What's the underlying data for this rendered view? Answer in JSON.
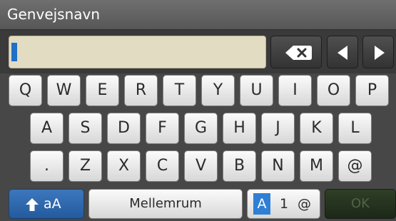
{
  "title": "Genvejsnavn",
  "input": {
    "value": ""
  },
  "controls": {
    "backspace_icon": "backspace-x-icon",
    "left_icon": "left-arrow-icon",
    "right_icon": "right-arrow-icon"
  },
  "keys": {
    "row1": [
      "Q",
      "W",
      "E",
      "R",
      "T",
      "Y",
      "U",
      "I",
      "O",
      "P"
    ],
    "row2": [
      "A",
      "S",
      "D",
      "F",
      "G",
      "H",
      "J",
      "K",
      "L"
    ],
    "row3": [
      ".",
      "Z",
      "X",
      "C",
      "V",
      "B",
      "N",
      "M",
      "@"
    ]
  },
  "bottom": {
    "shift_icon": "up-arrow-icon",
    "shift_label": "aA",
    "space_label": "Mellemrum",
    "mode_active": "A",
    "mode_num": "1",
    "mode_sym": "@",
    "ok_label": "OK"
  },
  "colors": {
    "title_bar": "#5f5f5f",
    "input_bg": "#e2dcc3",
    "cursor": "#1e70c8",
    "shift_blue": "#2f6bb0",
    "ok_disabled": "#26331f"
  }
}
